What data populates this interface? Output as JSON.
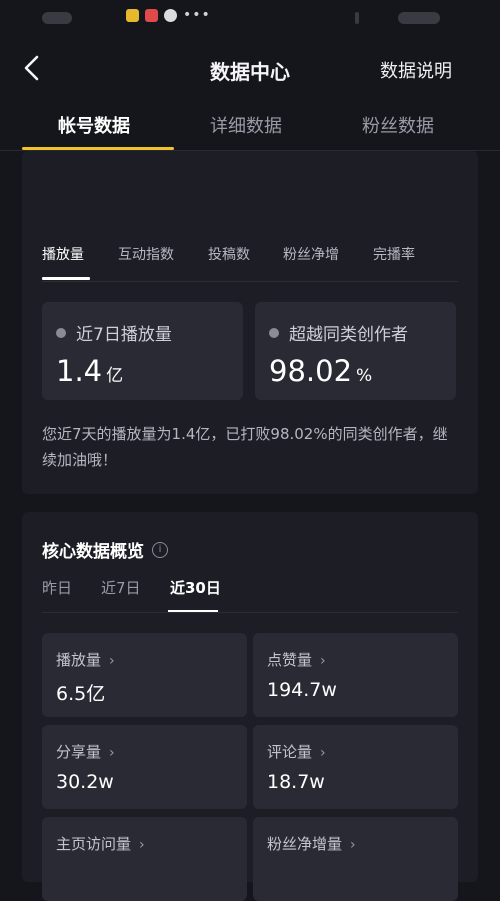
{
  "header": {
    "title": "数据中心",
    "help_link": "数据说明"
  },
  "tabs": [
    {
      "label": "帐号数据",
      "active": true
    },
    {
      "label": "详细数据",
      "active": false
    },
    {
      "label": "粉丝数据",
      "active": false
    }
  ],
  "overview": {
    "metric_tabs": [
      "播放量",
      "互动指数",
      "投稿数",
      "粉丝净增",
      "完播率"
    ],
    "active_metric": "播放量",
    "stats": [
      {
        "label": "近7日播放量",
        "value": "1.4",
        "unit": "亿"
      },
      {
        "label": "超越同类创作者",
        "value": "98.02",
        "unit": "%"
      }
    ],
    "description": "您近7天的播放量为1.4亿，已打败98.02%的同类创作者，继续加油哦！"
  },
  "core": {
    "title": "核心数据概览",
    "ranges": [
      "昨日",
      "近7日",
      "近30日"
    ],
    "active_range": "近30日",
    "metrics": [
      {
        "label": "播放量",
        "value": "6.5亿"
      },
      {
        "label": "点赞量",
        "value": "194.7w"
      },
      {
        "label": "分享量",
        "value": "30.2w"
      },
      {
        "label": "评论量",
        "value": "18.7w"
      },
      {
        "label": "主页访问量",
        "value": ""
      },
      {
        "label": "粉丝净增量",
        "value": ""
      }
    ],
    "chevron": "›"
  },
  "colors": {
    "background": "#15151c",
    "card": "#1d1d26",
    "tile": "#2a2a34",
    "accent": "#f4c22b"
  },
  "icons": {
    "back": "chevron-left-icon",
    "info": "info-circle-icon"
  }
}
